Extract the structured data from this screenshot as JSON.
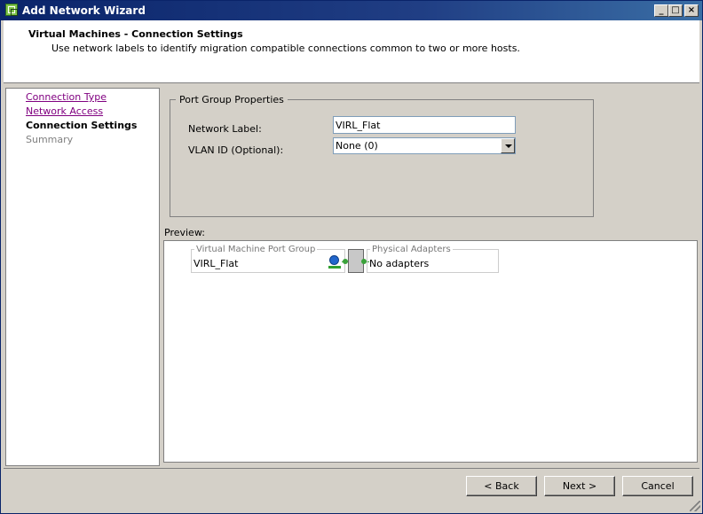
{
  "window": {
    "title": "Add Network Wizard",
    "controls": {
      "minimize": "_",
      "maximize": "□",
      "close": "×"
    }
  },
  "header": {
    "title": "Virtual Machines - Connection Settings",
    "description": "Use network labels to identify migration compatible connections common to two or more hosts."
  },
  "nav": {
    "items": [
      {
        "label": "Connection Type",
        "state": "link"
      },
      {
        "label": "Network Access",
        "state": "link"
      },
      {
        "label": "Connection Settings",
        "state": "current"
      },
      {
        "label": "Summary",
        "state": "disabled"
      }
    ]
  },
  "port_group": {
    "group_title": "Port Group Properties",
    "network_label_caption": "Network Label:",
    "network_label_value": "VIRL_Flat",
    "vlan_caption": "VLAN ID (Optional):",
    "vlan_value": "None (0)"
  },
  "preview": {
    "label": "Preview:",
    "vm_port_group_caption": "Virtual Machine Port Group",
    "vm_port_group_value": "VIRL_Flat",
    "physical_adapters_caption": "Physical Adapters",
    "physical_adapters_value": "No adapters"
  },
  "buttons": {
    "back": "< Back",
    "next": "Next >",
    "cancel": "Cancel"
  },
  "icons": {
    "app": "network-wizard-icon",
    "globe": "port-group-globe-icon",
    "switch": "virtual-switch-icon",
    "grip": "resize-grip-icon"
  }
}
